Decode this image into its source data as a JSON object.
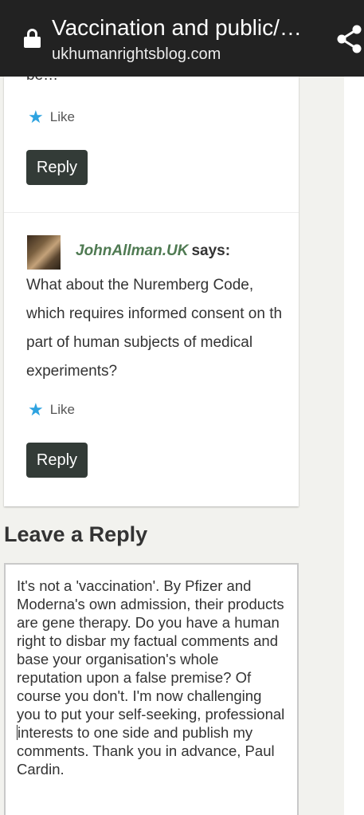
{
  "browser": {
    "title": "Vaccination and public/…",
    "domain": "ukhumanrightsblog.com",
    "lock_icon": "lock-icon",
    "share_icon": "share-icon"
  },
  "comment_prev": {
    "cutoff_text": "be…",
    "like_label": "Like",
    "reply_label": "Reply"
  },
  "comment": {
    "author": "JohnAllman.UK",
    "says": "says:",
    "text": "What about the Nuremberg Code, which requires informed consent on th part of human subjects of medical experiments?",
    "like_label": "Like",
    "reply_label": "Reply"
  },
  "reply_form": {
    "heading": "Leave a Reply",
    "text_before_caret": "It's not a 'vaccination'. By Pfizer and Moderna's own admission, their products are gene therapy. Do you have a human right to disbar my factual comments and base your organisation's whole reputation upon a false premise? Of course you don't. I'm now challenging you to put your self-seeking, professional ",
    "text_after_caret": "interests to one side and publish my comments. Thank you in advance, Paul Cardin."
  },
  "colors": {
    "topbar": "#222222",
    "button": "#333b37",
    "author": "#4f7a52",
    "like_star": "#2ea3e0"
  }
}
